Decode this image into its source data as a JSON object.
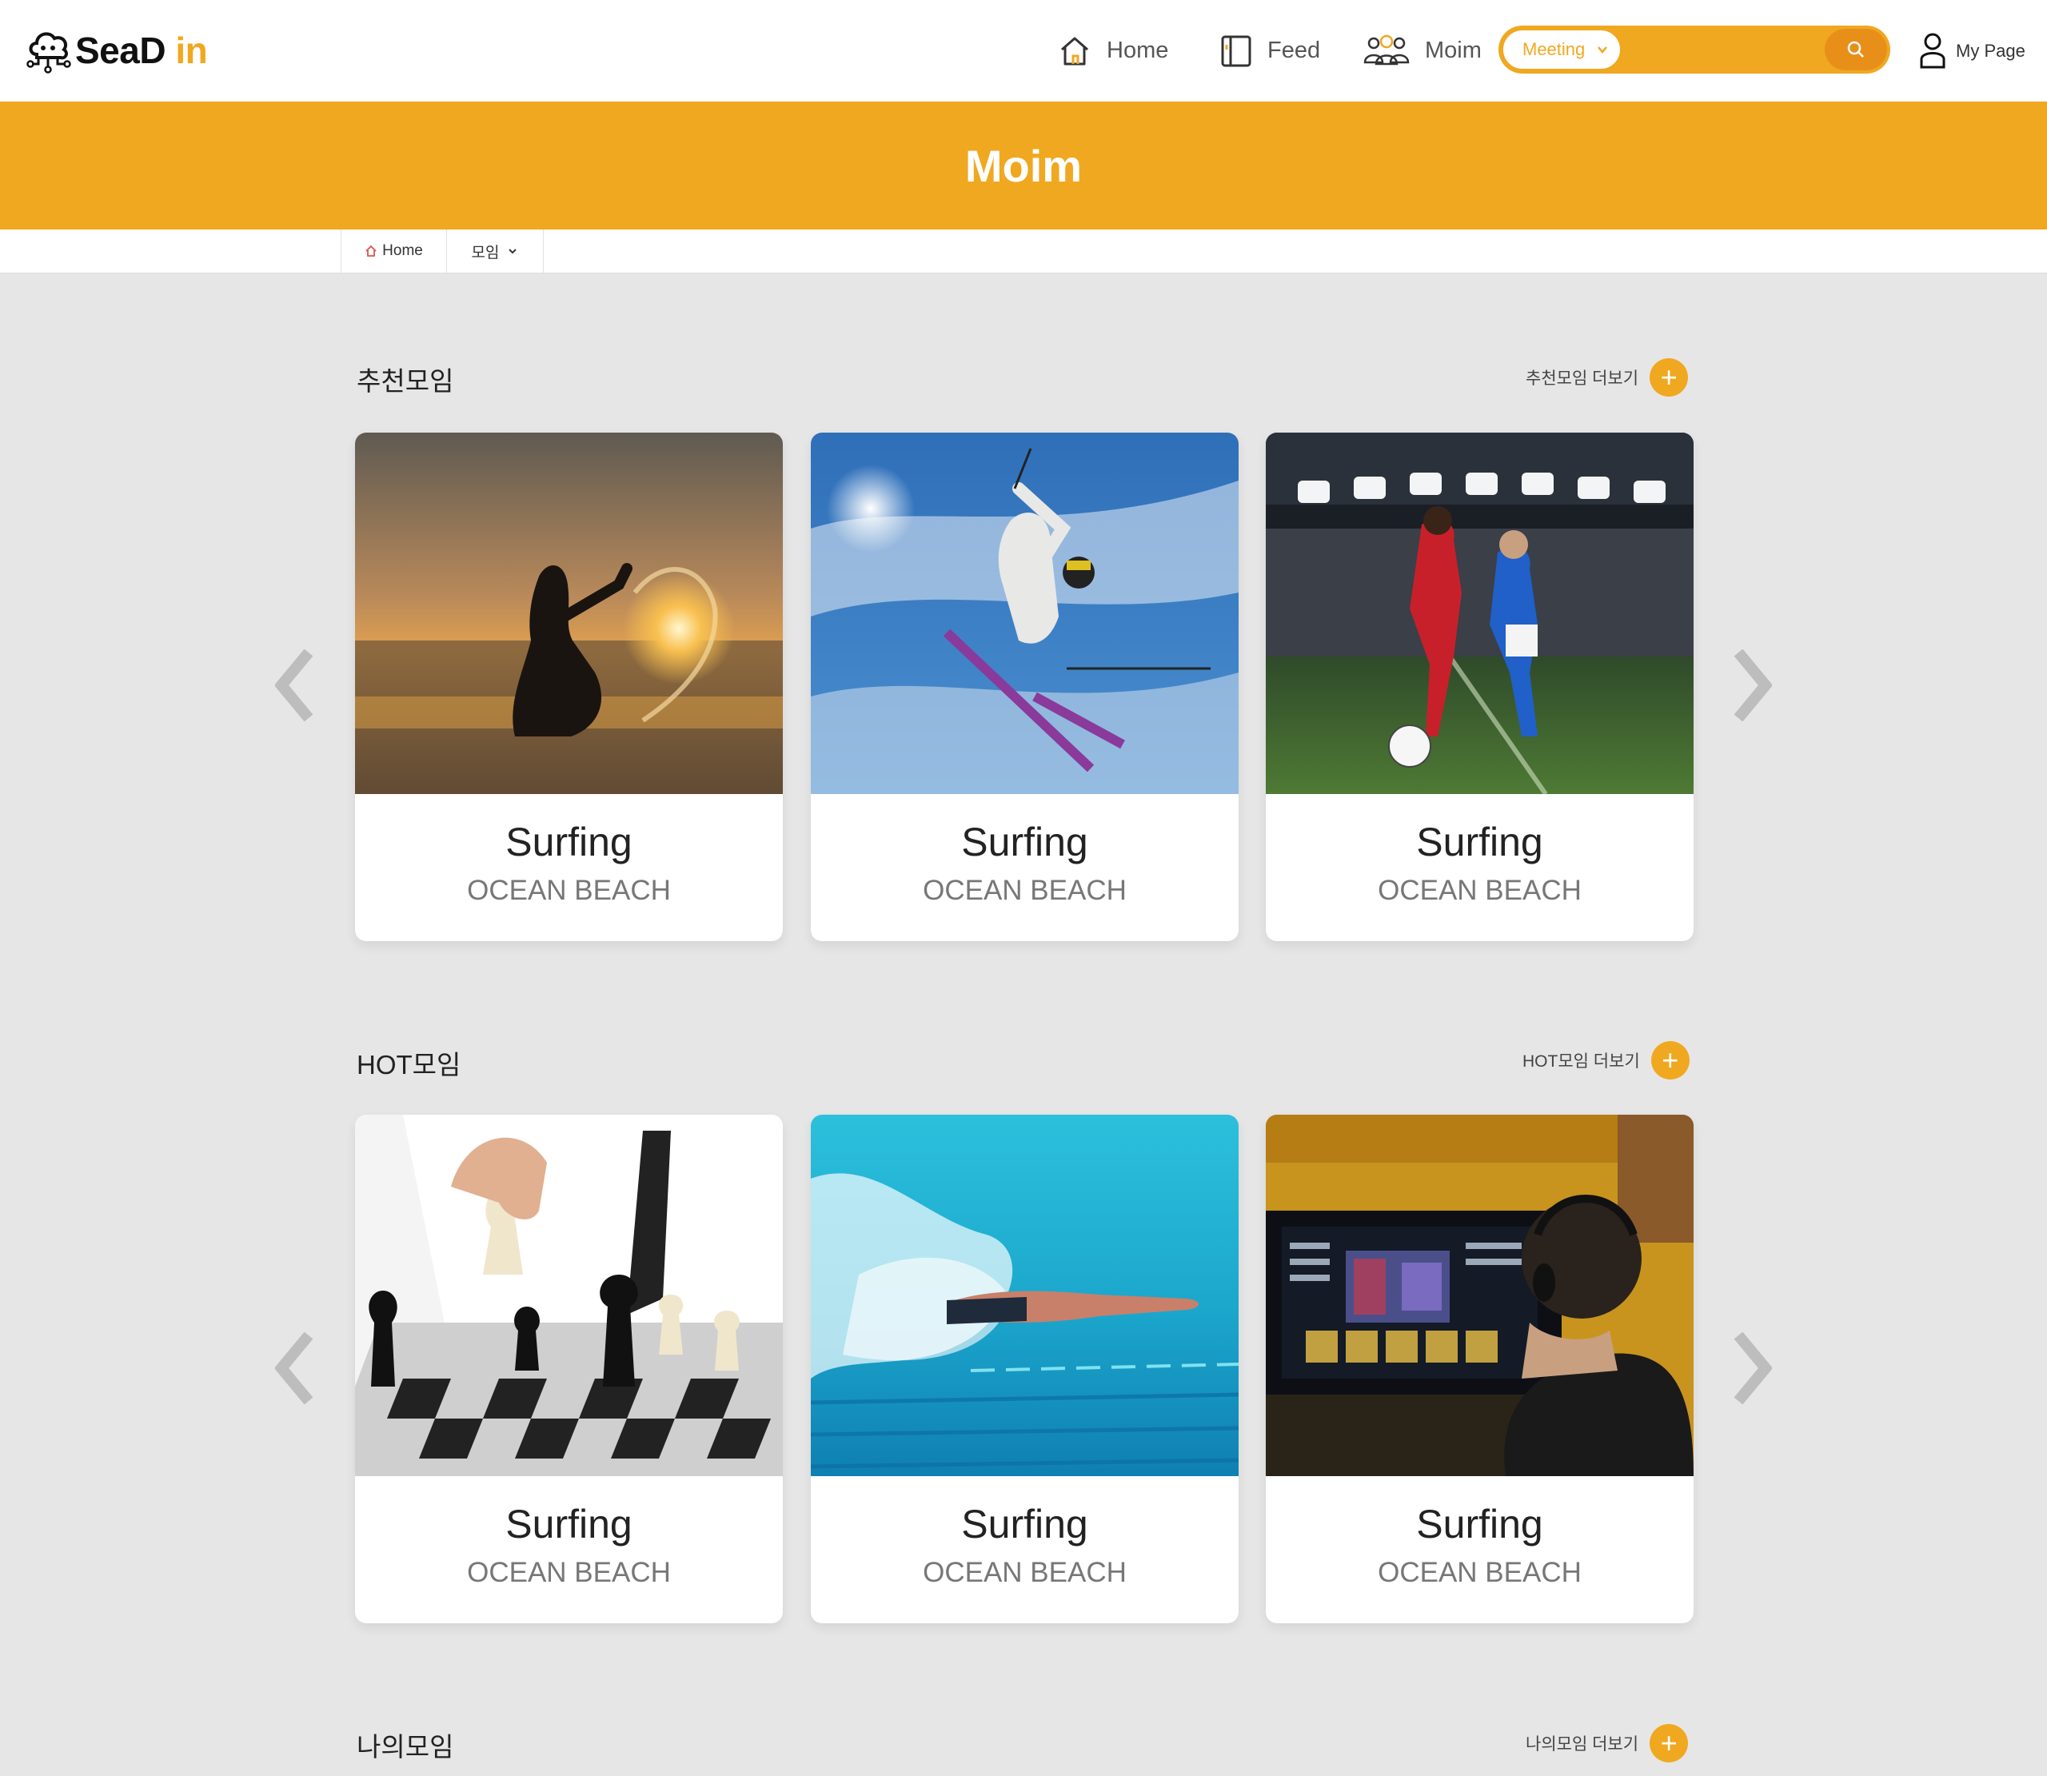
{
  "brand": {
    "name_dark": "SeaD",
    "name_accent": "in",
    "accent_color": "#f0a820"
  },
  "nav": {
    "home": "Home",
    "feed": "Feed",
    "moim": "Moim",
    "mypage": "My Page"
  },
  "search": {
    "category": "Meeting",
    "placeholder": "",
    "value": ""
  },
  "banner": {
    "title": "Moim"
  },
  "breadcrumb": {
    "home": "Home",
    "current": "모임"
  },
  "sections": [
    {
      "title": "추천모임",
      "more_label": "추천모임 더보기",
      "cards": [
        {
          "title": "Surfing",
          "subtitle": "OCEAN BEACH",
          "image": "surfer-sunset-photo"
        },
        {
          "title": "Surfing",
          "subtitle": "OCEAN BEACH",
          "image": "skier-jump-photo"
        },
        {
          "title": "Surfing",
          "subtitle": "OCEAN BEACH",
          "image": "soccer-match-photo"
        }
      ]
    },
    {
      "title": "HOT모임",
      "more_label": "HOT모임 더보기",
      "cards": [
        {
          "title": "Surfing",
          "subtitle": "OCEAN BEACH",
          "image": "chess-game-photo"
        },
        {
          "title": "Surfing",
          "subtitle": "OCEAN BEACH",
          "image": "swimmer-pool-photo"
        },
        {
          "title": "Surfing",
          "subtitle": "OCEAN BEACH",
          "image": "gamer-screen-photo"
        }
      ]
    },
    {
      "title": "나의모임",
      "more_label": "나의모임 더보기",
      "cards": []
    }
  ]
}
